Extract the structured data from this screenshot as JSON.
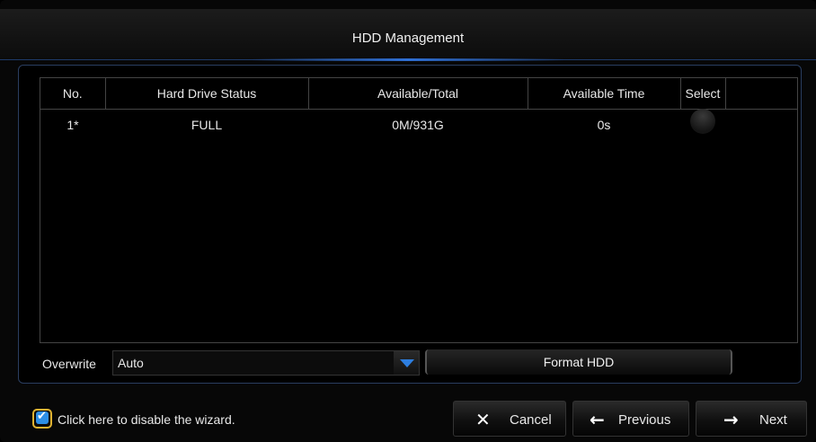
{
  "window": {
    "title": "HDD Management"
  },
  "table": {
    "columns": [
      "No.",
      "Hard Drive Status",
      "Available/Total",
      "Available Time",
      "Select"
    ],
    "rows": [
      {
        "no": "1*",
        "status": "FULL",
        "available_total": "0M/931G",
        "available_time": "0s"
      }
    ]
  },
  "overwrite": {
    "label": "Overwrite",
    "value": "Auto"
  },
  "format_button": "Format HDD",
  "footer": {
    "disable_wizard_label": "Click here to disable the wizard.",
    "disable_wizard_checked": true,
    "cancel_label": "Cancel",
    "previous_label": "Previous",
    "next_label": "Next"
  },
  "colors": {
    "accent": "#2d7ee0",
    "checkbox_border": "#e0b230"
  }
}
